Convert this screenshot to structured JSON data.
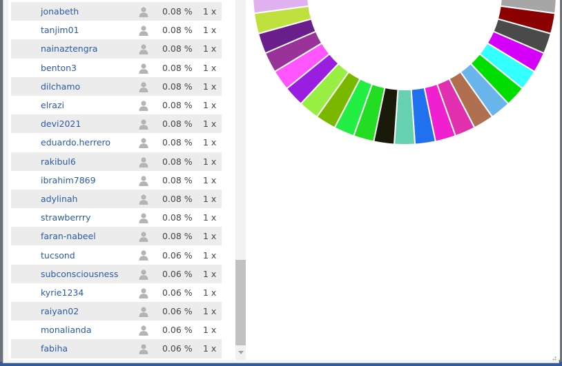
{
  "users": {
    "rows": [
      {
        "name": "jonabeth",
        "percent": "0.08 %",
        "count": "1 x"
      },
      {
        "name": "tanjim01",
        "percent": "0.08 %",
        "count": "1 x"
      },
      {
        "name": "nainaztengra",
        "percent": "0.08 %",
        "count": "1 x"
      },
      {
        "name": "benton3",
        "percent": "0.08 %",
        "count": "1 x"
      },
      {
        "name": "dilchamo",
        "percent": "0.08 %",
        "count": "1 x"
      },
      {
        "name": "elrazi",
        "percent": "0.08 %",
        "count": "1 x"
      },
      {
        "name": "devi2021",
        "percent": "0.08 %",
        "count": "1 x"
      },
      {
        "name": "eduardo.herrero",
        "percent": "0.08 %",
        "count": "1 x"
      },
      {
        "name": "rakibul6",
        "percent": "0.08 %",
        "count": "1 x"
      },
      {
        "name": "ibrahim7869",
        "percent": "0.08 %",
        "count": "1 x"
      },
      {
        "name": "adylinah",
        "percent": "0.08 %",
        "count": "1 x"
      },
      {
        "name": "strawberrry",
        "percent": "0.08 %",
        "count": "1 x"
      },
      {
        "name": "faran-nabeel",
        "percent": "0.08 %",
        "count": "1 x"
      },
      {
        "name": "tucsond",
        "percent": "0.06 %",
        "count": "1 x"
      },
      {
        "name": "subconsciousness",
        "percent": "0.06 %",
        "count": "1 x"
      },
      {
        "name": "kyrie1234",
        "percent": "0.06 %",
        "count": "1 x"
      },
      {
        "name": "raiyan02",
        "percent": "0.06 %",
        "count": "1 x"
      },
      {
        "name": "monalianda",
        "percent": "0.06 %",
        "count": "1 x"
      },
      {
        "name": "fabiha",
        "percent": "0.06 %",
        "count": "1 x"
      }
    ],
    "row_icon": "user-icon"
  },
  "chart": {
    "type": "donut",
    "visible_segment_colors": [
      "#1e88e5",
      "#a6a6a6",
      "#8b0000",
      "#4a4a4a",
      "#d500f9",
      "#33ffff",
      "#00dd00",
      "#6ab4ec",
      "#b07050",
      "#e030b0",
      "#f020d0",
      "#2070f0",
      "#66d0b0",
      "#1a1a0a",
      "#22dd22",
      "#22ee44",
      "#7ab800",
      "#99ee44",
      "#9a1ee0",
      "#ff55ff",
      "#993399",
      "#6a1e8c",
      "#c0e040",
      "#e0b0f0",
      "#e01070"
    ]
  }
}
